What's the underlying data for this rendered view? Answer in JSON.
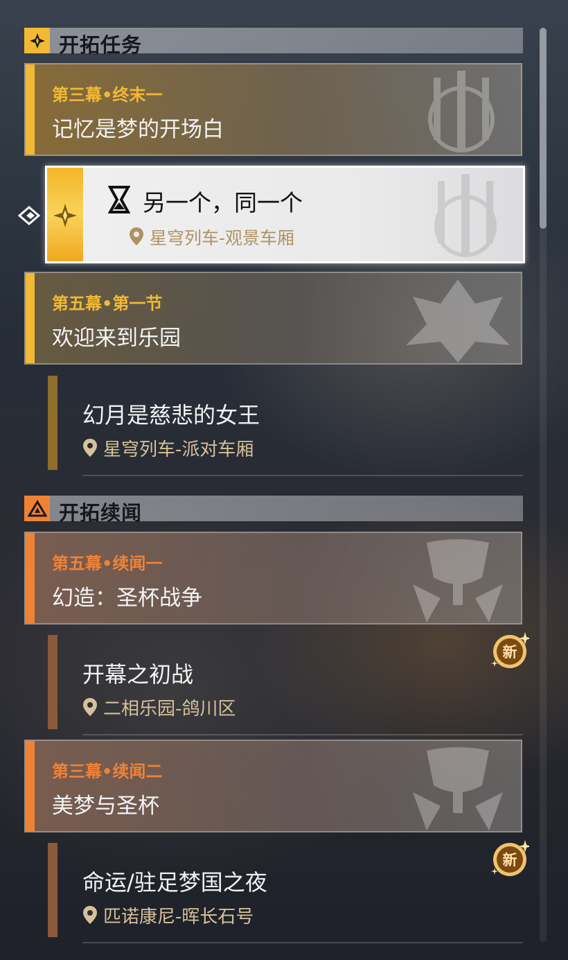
{
  "colors": {
    "gold": "#f2b934",
    "orange": "#f08236",
    "quest_bar_gold": "#8e6e2c",
    "quest_bar_orange": "#8a5a3a"
  },
  "sections": {
    "trailblaze": {
      "title": "开拓任务",
      "icon": "trailblaze-mission-icon"
    },
    "companion": {
      "title": "开拓续闻",
      "icon": "companion-mission-icon"
    }
  },
  "chapters": [
    {
      "subtitle": "第三幕•终末一",
      "title": "记忆是梦的开场白"
    },
    {
      "subtitle": "第五幕•第一节",
      "title": "欢迎来到乐园"
    },
    {
      "subtitle": "第五幕•续闻一",
      "title": "幻造：圣杯战争"
    },
    {
      "subtitle": "第三幕•续闻二",
      "title": "美梦与圣杯"
    }
  ],
  "selected_quest": {
    "title": "另一个，同一个",
    "location": "星穹列车-观景车厢",
    "status_icon": "hourglass-icon"
  },
  "quests": [
    {
      "title": "幻月是慈悲的女王",
      "location": "星穹列车-派对车厢"
    },
    {
      "title": "开幕之初战",
      "location": "二相乐园-鸽川区",
      "badge": "新"
    },
    {
      "title": "命运/驻足梦国之夜",
      "location": "匹诺康尼-晖长石号",
      "badge": "新"
    }
  ]
}
